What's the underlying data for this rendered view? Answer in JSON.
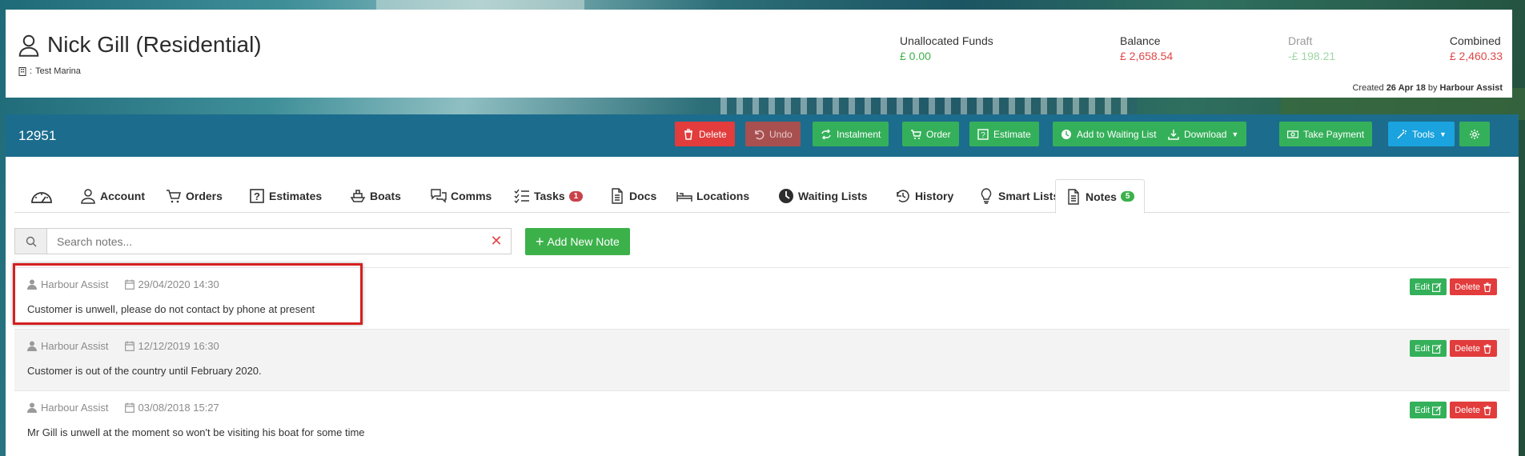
{
  "customer": {
    "name": "Nick Gill (Residential)",
    "marina_prefix": ": ",
    "marina": "Test Marina"
  },
  "funds": {
    "unallocated_label": "Unallocated Funds",
    "unallocated_value": "£ 0.00",
    "balance_label": "Balance",
    "balance_value": "£ 2,658.54",
    "draft_label": "Draft",
    "draft_value": "-£ 198.21",
    "combined_label": "Combined",
    "combined_value": "£ 2,460.33"
  },
  "created": {
    "prefix": "Created ",
    "date": "26 Apr 18",
    "by_text": " by ",
    "by": "Harbour Assist"
  },
  "account_number": "12951",
  "toolbar": {
    "delete": "Delete",
    "undo": "Undo",
    "instalment": "Instalment",
    "order": "Order",
    "estimate": "Estimate",
    "add_waiting": "Add to Waiting List",
    "download": "Download",
    "take_payment": "Take Payment",
    "tools": "Tools"
  },
  "tabs": {
    "account": "Account",
    "orders": "Orders",
    "estimates": "Estimates",
    "boats": "Boats",
    "comms": "Comms",
    "tasks": "Tasks",
    "tasks_count": "1",
    "docs": "Docs",
    "locations": "Locations",
    "waiting_lists": "Waiting Lists",
    "history": "History",
    "smart_lists": "Smart Lists",
    "notes": "Notes",
    "notes_count": "5"
  },
  "search": {
    "placeholder": "Search notes..."
  },
  "add_note_label": "Add New Note",
  "note_buttons": {
    "edit": "Edit",
    "delete": "Delete"
  },
  "notes": [
    {
      "author": "Harbour Assist",
      "datetime": "29/04/2020 14:30",
      "text": "Customer is unwell, please do not contact by phone at present"
    },
    {
      "author": "Harbour Assist",
      "datetime": "12/12/2019 16:30",
      "text": "Customer is out of the country until February 2020."
    },
    {
      "author": "Harbour Assist",
      "datetime": "03/08/2018 15:27",
      "text": "Mr Gill is unwell at the moment so won't be visiting his boat for some time"
    }
  ],
  "colors": {
    "toolbar_bg": "#1c6c8d",
    "green": "#35b05a",
    "red": "#e23c3c",
    "blue": "#1aa3de",
    "highlight": "#d42020"
  }
}
